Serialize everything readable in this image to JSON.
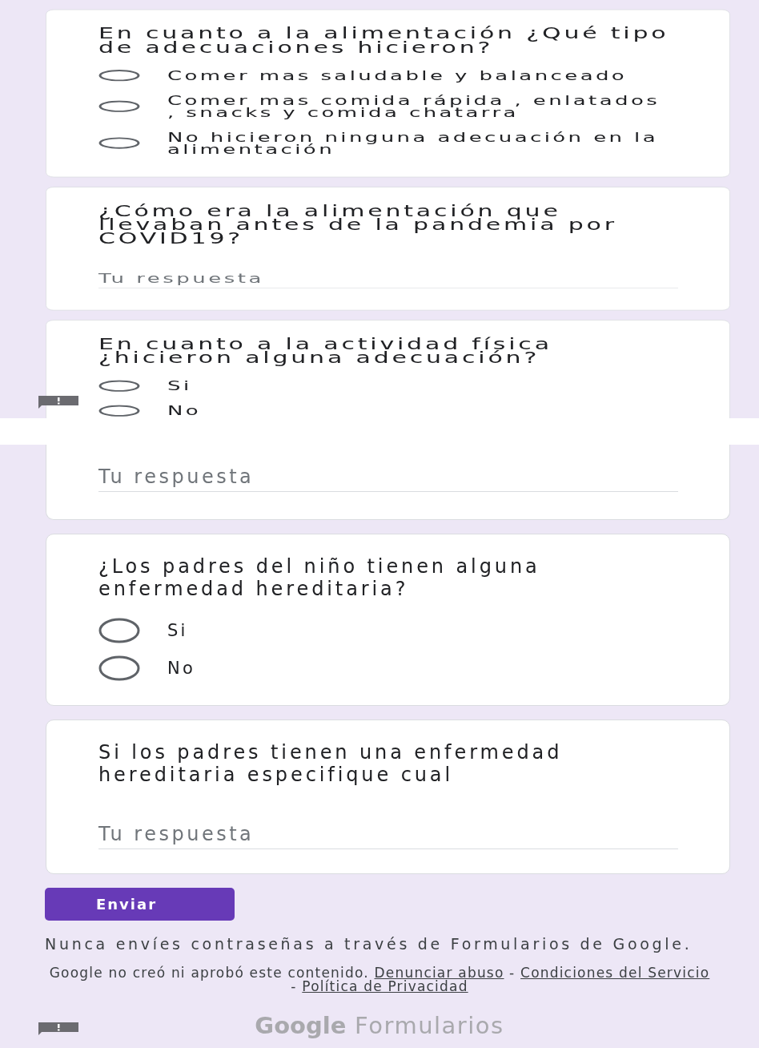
{
  "screens": [
    {
      "cards": [
        {
          "kind": "radio",
          "title": "En cuanto a la alimentación ¿Qué tipo de adecuaciones hicieron?",
          "options": [
            {
              "label": "Comer mas saludable y balanceado",
              "selected": false
            },
            {
              "label": "Comer mas comida rápida , enlatados , snacks y comida chatarra",
              "selected": false
            },
            {
              "label": "No hicieron ninguna adecuación en la alimentación",
              "selected": false
            }
          ]
        },
        {
          "kind": "text",
          "title": "¿Cómo era la alimentación que llevaban antes de la pandemia por COVID19?",
          "placeholder": "Tu respuesta"
        },
        {
          "kind": "radio",
          "title": "En cuanto a la actividad física ¿hicieron alguna adecuación?",
          "options": [
            {
              "label": "Si",
              "selected": false
            },
            {
              "label": "No",
              "selected": false
            }
          ]
        }
      ]
    },
    {
      "cards": [
        {
          "kind": "text",
          "placeholder": "Tu respuesta"
        },
        {
          "kind": "radio",
          "title": "¿Los padres del niño tienen alguna enfermedad hereditaria?",
          "options": [
            {
              "label": "Si",
              "selected": false
            },
            {
              "label": "No",
              "selected": false
            }
          ]
        },
        {
          "kind": "text",
          "title": "Si los padres tienen una enfermedad hereditaria especifique cual",
          "placeholder": "Tu respuesta"
        }
      ],
      "submit": "Enviar",
      "notice": "Nunca envíes contraseñas a través de Formularios de Google.",
      "footer": {
        "text": "Google no creó ni aprobó este contenido.",
        "links": [
          "Denunciar abuso",
          "Condiciones del Servicio",
          "Política de Privacidad"
        ],
        "separator": "-"
      },
      "logo": "**Google** Formularios"
    }
  ]
}
